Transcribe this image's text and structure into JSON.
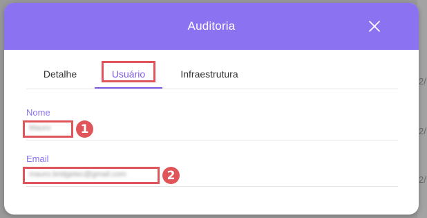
{
  "modal": {
    "title": "Auditoria",
    "close_icon": "close-icon",
    "accent_color": "#8b72f0"
  },
  "tabs": [
    {
      "label": "Detalhe",
      "active": false
    },
    {
      "label": "Usuário",
      "active": true
    },
    {
      "label": "Infraestrutura",
      "active": false
    }
  ],
  "fields": {
    "nome": {
      "label": "Nome",
      "value": "Mauro"
    },
    "email": {
      "label": "Email",
      "value": "mauro.bridgetec@gmail.com"
    }
  },
  "annotations": {
    "badge_1": "1",
    "badge_2": "2",
    "color": "#e0555a"
  },
  "background": {
    "row_fragments": [
      "2/",
      "2/",
      "2/",
      "2/"
    ]
  }
}
